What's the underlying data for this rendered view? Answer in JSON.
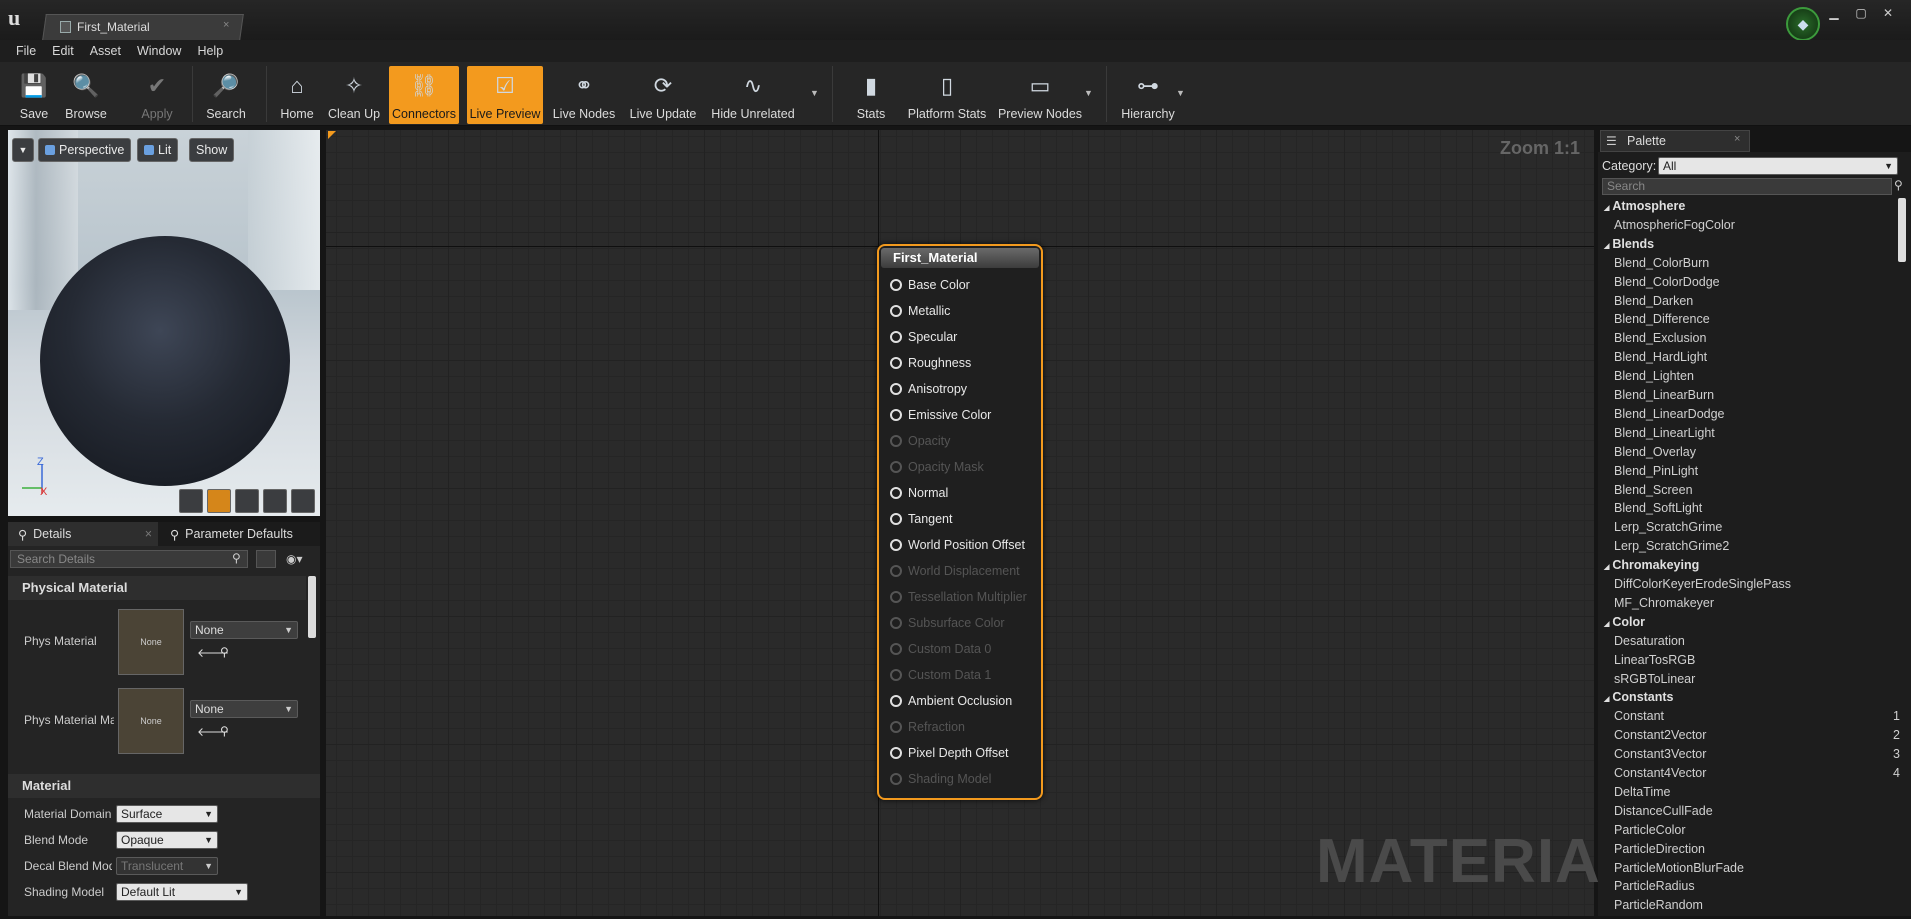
{
  "window": {
    "doc_tab": "First_Material",
    "close_glyph": "×",
    "minimize": "▁",
    "maximize": "▢",
    "close": "✕"
  },
  "menu": [
    "File",
    "Edit",
    "Asset",
    "Window",
    "Help"
  ],
  "toolbar": [
    {
      "label": "Save",
      "icon": "save-icon"
    },
    {
      "label": "Browse",
      "icon": "browse-icon"
    },
    {
      "label": "Apply",
      "icon": "apply-icon",
      "disabled": true
    },
    {
      "label": "Search",
      "icon": "search-icon"
    },
    {
      "label": "Home",
      "icon": "home-icon"
    },
    {
      "label": "Clean Up",
      "icon": "cleanup-icon"
    },
    {
      "label": "Connectors",
      "icon": "connectors-icon",
      "active": true
    },
    {
      "label": "Live Preview",
      "icon": "live-preview-icon",
      "active": true
    },
    {
      "label": "Live Nodes",
      "icon": "live-nodes-icon"
    },
    {
      "label": "Live Update",
      "icon": "live-update-icon"
    },
    {
      "label": "Hide Unrelated",
      "icon": "hide-unrelated-icon"
    },
    {
      "label": "Stats",
      "icon": "stats-icon"
    },
    {
      "label": "Platform Stats",
      "icon": "platform-stats-icon"
    },
    {
      "label": "Preview Nodes",
      "icon": "preview-nodes-icon"
    },
    {
      "label": "Hierarchy",
      "icon": "hierarchy-icon"
    }
  ],
  "viewport": {
    "perspective": "Perspective",
    "lit": "Lit",
    "show": "Show",
    "axis_z": "Z",
    "axis_x": "X"
  },
  "details": {
    "tab_details": "Details",
    "tab_params": "Parameter Defaults",
    "search_placeholder": "Search Details",
    "physical_material_header": "Physical Material",
    "phys_material_label": "Phys Material",
    "phys_material_map_label": "Phys Material Ma",
    "thumb_none": "None",
    "dropdown_none": "None",
    "material_header": "Material",
    "material_domain_label": "Material Domain",
    "material_domain_value": "Surface",
    "blend_mode_label": "Blend Mode",
    "blend_mode_value": "Opaque",
    "decal_blend_label": "Decal Blend Mode",
    "decal_blend_value": "Translucent",
    "shading_model_label": "Shading Model",
    "shading_model_value": "Default Lit"
  },
  "graph": {
    "zoom": "Zoom 1:1",
    "watermark": "MATERIAL"
  },
  "node": {
    "title": "First_Material",
    "pins": [
      {
        "label": "Base Color",
        "enabled": true
      },
      {
        "label": "Metallic",
        "enabled": true
      },
      {
        "label": "Specular",
        "enabled": true
      },
      {
        "label": "Roughness",
        "enabled": true
      },
      {
        "label": "Anisotropy",
        "enabled": true
      },
      {
        "label": "Emissive Color",
        "enabled": true
      },
      {
        "label": "Opacity",
        "enabled": false
      },
      {
        "label": "Opacity Mask",
        "enabled": false
      },
      {
        "label": "Normal",
        "enabled": true
      },
      {
        "label": "Tangent",
        "enabled": true
      },
      {
        "label": "World Position Offset",
        "enabled": true
      },
      {
        "label": "World Displacement",
        "enabled": false
      },
      {
        "label": "Tessellation Multiplier",
        "enabled": false
      },
      {
        "label": "Subsurface Color",
        "enabled": false
      },
      {
        "label": "Custom Data 0",
        "enabled": false
      },
      {
        "label": "Custom Data 1",
        "enabled": false
      },
      {
        "label": "Ambient Occlusion",
        "enabled": true
      },
      {
        "label": "Refraction",
        "enabled": false
      },
      {
        "label": "Pixel Depth Offset",
        "enabled": true
      },
      {
        "label": "Shading Model",
        "enabled": false
      }
    ]
  },
  "palette": {
    "tab": "Palette",
    "category_label": "Category:",
    "category_value": "All",
    "search_placeholder": "Search",
    "items": [
      {
        "text": "Atmosphere",
        "cat": true
      },
      {
        "text": "AtmosphericFogColor"
      },
      {
        "text": "Blends",
        "cat": true
      },
      {
        "text": "Blend_ColorBurn"
      },
      {
        "text": "Blend_ColorDodge"
      },
      {
        "text": "Blend_Darken"
      },
      {
        "text": "Blend_Difference"
      },
      {
        "text": "Blend_Exclusion"
      },
      {
        "text": "Blend_HardLight"
      },
      {
        "text": "Blend_Lighten"
      },
      {
        "text": "Blend_LinearBurn"
      },
      {
        "text": "Blend_LinearDodge"
      },
      {
        "text": "Blend_LinearLight"
      },
      {
        "text": "Blend_Overlay"
      },
      {
        "text": "Blend_PinLight"
      },
      {
        "text": "Blend_Screen"
      },
      {
        "text": "Blend_SoftLight"
      },
      {
        "text": "Lerp_ScratchGrime"
      },
      {
        "text": "Lerp_ScratchGrime2"
      },
      {
        "text": "Chromakeying",
        "cat": true
      },
      {
        "text": "DiffColorKeyerErodeSinglePass"
      },
      {
        "text": "MF_Chromakeyer"
      },
      {
        "text": "Color",
        "cat": true
      },
      {
        "text": "Desaturation"
      },
      {
        "text": "LinearTosRGB"
      },
      {
        "text": "sRGBToLinear"
      },
      {
        "text": "Constants",
        "cat": true
      },
      {
        "text": "Constant",
        "key": "1"
      },
      {
        "text": "Constant2Vector",
        "key": "2"
      },
      {
        "text": "Constant3Vector",
        "key": "3"
      },
      {
        "text": "Constant4Vector",
        "key": "4"
      },
      {
        "text": "DeltaTime"
      },
      {
        "text": "DistanceCullFade"
      },
      {
        "text": "ParticleColor"
      },
      {
        "text": "ParticleDirection"
      },
      {
        "text": "ParticleMotionBlurFade"
      },
      {
        "text": "ParticleRadius"
      },
      {
        "text": "ParticleRandom"
      }
    ]
  },
  "colors": {
    "accent": "#f39a1e",
    "background": "#151515"
  }
}
